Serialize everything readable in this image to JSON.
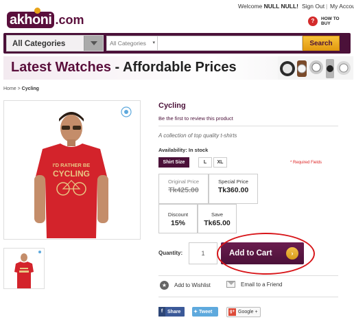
{
  "top": {
    "welcome_prefix": "Welcome",
    "welcome_user": "NULL NULL!",
    "sign_out": "Sign Out",
    "my_account": "My Account"
  },
  "logo": {
    "word": "akhoni",
    "suffix": ".com"
  },
  "how_to_buy": {
    "line1": "HOW TO",
    "line2": "BUY"
  },
  "nav": {
    "category_label": "All Categories",
    "search_category": "All Categories",
    "search_value": "",
    "search_button": "Search"
  },
  "banner": {
    "part1": "Latest Watches",
    "dash": " - ",
    "part2": "Affordable Prices"
  },
  "breadcrumb": {
    "home": "Home",
    "sep": " > ",
    "current": "Cycling"
  },
  "product": {
    "title": "Cycling",
    "review_link": "Be the first to review this product",
    "description": "A collection of top quality t-shirts",
    "availability_label": "Availability:",
    "availability_value": "In stock",
    "size_label": "Shirt Size",
    "sizes": [
      "L",
      "XL"
    ],
    "required_note": "* Required Fields",
    "shirt_text_line1": "I'D RATHER BE",
    "shirt_text_line2": "CYCLING"
  },
  "prices": {
    "original_label": "Original Price",
    "original_value": "Tk425.00",
    "special_label": "Special Price",
    "special_value": "Tk360.00",
    "discount_label": "Discount",
    "discount_value": "15%",
    "save_label": "Save",
    "save_value": "Tk65.00"
  },
  "cart": {
    "quantity_label": "Quantity:",
    "quantity_value": "1",
    "add_to_cart": "Add to Cart",
    "arrow": "›"
  },
  "actions": {
    "wishlist": "Add to Wishlist",
    "email": "Email to a Friend"
  },
  "social": {
    "share": "Share",
    "tweet": "Tweet",
    "google": "Google +"
  },
  "colors": {
    "brand_purple": "#4b1139",
    "accent_orange": "#e8a317",
    "highlight_red": "#d8161a",
    "shirt_red": "#d3232b"
  }
}
